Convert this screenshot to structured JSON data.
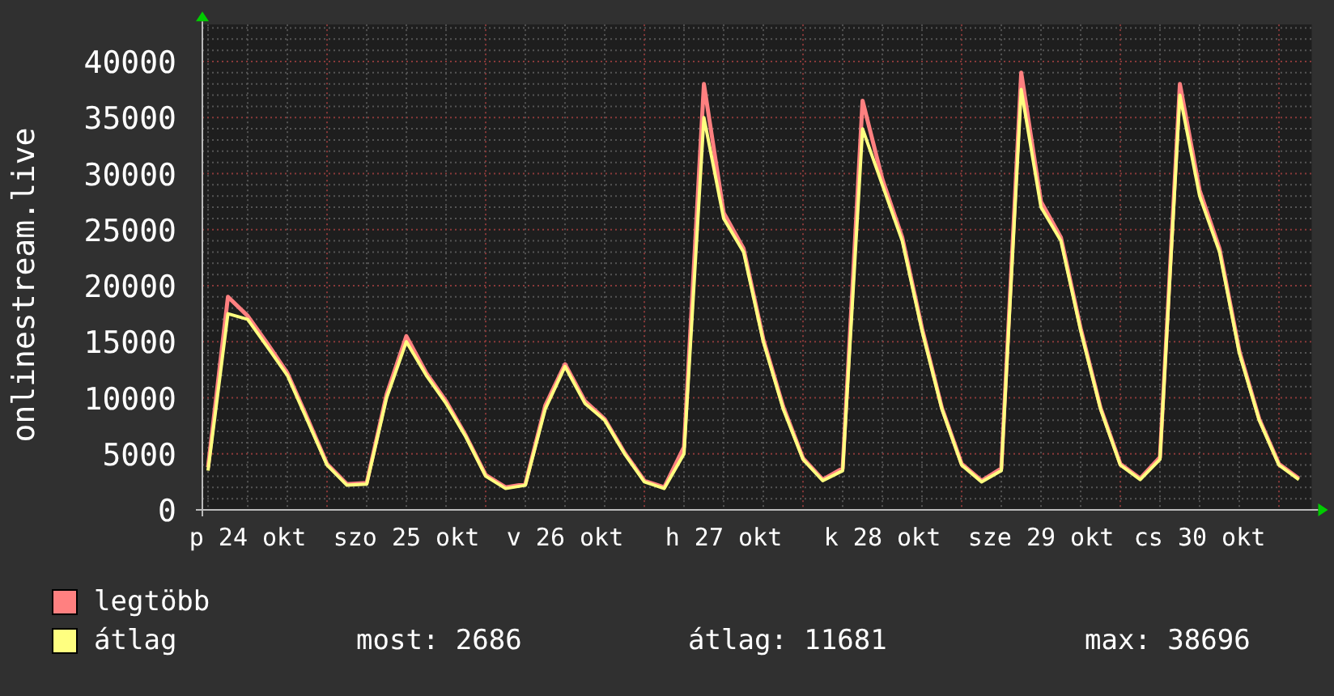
{
  "chart_data": {
    "type": "line",
    "ylabel": "onlinestream.live",
    "categories": [
      null,
      null,
      "p 24 okt",
      null,
      null,
      null,
      null,
      null,
      null,
      null,
      "szo 25 okt",
      null,
      null,
      null,
      null,
      null,
      null,
      null,
      "v 26 okt",
      null,
      null,
      null,
      null,
      null,
      null,
      null,
      "h 27 okt",
      null,
      null,
      null,
      null,
      null,
      null,
      null,
      "k 28 okt",
      null,
      null,
      null,
      null,
      null,
      null,
      null,
      "sze 29 okt",
      null,
      null,
      null,
      null,
      null,
      null,
      null,
      "cs 30 okt",
      null,
      null,
      null,
      null,
      null
    ],
    "series": [
      {
        "name": "legtöbb",
        "color": "#ff8080",
        "values": [
          3800,
          19000,
          17300,
          14800,
          12200,
          8200,
          4100,
          2300,
          2400,
          10300,
          15500,
          12200,
          9700,
          6600,
          3100,
          2000,
          2300,
          9300,
          13000,
          9700,
          8100,
          5100,
          2600,
          2000,
          5600,
          38000,
          26500,
          23300,
          15200,
          9200,
          4600,
          2700,
          3700,
          36500,
          29500,
          24300,
          16200,
          9100,
          4100,
          2600,
          3700,
          39000,
          27500,
          24300,
          16200,
          9100,
          4100,
          2800,
          4700,
          38000,
          28500,
          23300,
          14200,
          8100,
          4100,
          2800
        ]
      },
      {
        "name": "átlag",
        "color": "#ffff80",
        "values": [
          3500,
          17500,
          17000,
          14500,
          12000,
          8000,
          4000,
          2200,
          2300,
          10000,
          15000,
          12000,
          9500,
          6500,
          3000,
          1900,
          2200,
          9000,
          12800,
          9500,
          8000,
          5000,
          2500,
          1900,
          5000,
          35000,
          26000,
          23000,
          15000,
          9000,
          4500,
          2600,
          3500,
          34000,
          29000,
          24000,
          16000,
          9000,
          4000,
          2500,
          3500,
          37500,
          27000,
          24000,
          16000,
          9000,
          4000,
          2700,
          4500,
          37000,
          28000,
          23000,
          14000,
          8000,
          4000,
          2700
        ]
      }
    ],
    "ylim": [
      0,
      43300
    ],
    "grid": true,
    "yticks": [
      0,
      5000,
      10000,
      15000,
      20000,
      25000,
      30000,
      35000,
      40000
    ]
  },
  "legend_stats": [
    "most: 2686",
    "átlag: 11681",
    "max: 38696"
  ]
}
